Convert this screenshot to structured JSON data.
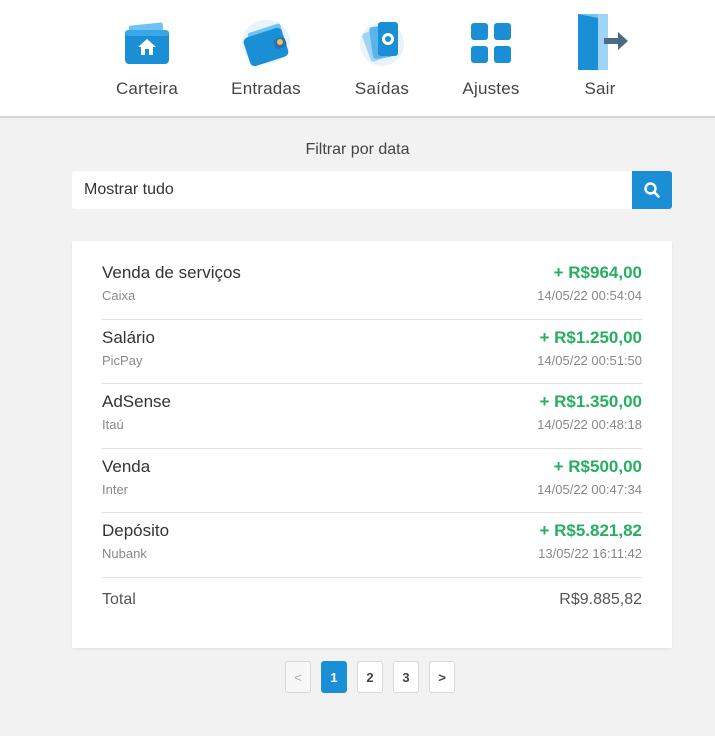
{
  "nav": {
    "items": [
      {
        "label": "Carteira",
        "icon": "wallet-home-icon"
      },
      {
        "label": "Entradas",
        "icon": "wallet-in-icon"
      },
      {
        "label": "Saídas",
        "icon": "money-out-icon"
      },
      {
        "label": "Ajustes",
        "icon": "grid-settings-icon"
      },
      {
        "label": "Sair",
        "icon": "exit-door-icon"
      }
    ]
  },
  "filter": {
    "title": "Filtrar por data",
    "placeholder": "Mostrar tudo",
    "value": ""
  },
  "transactions": [
    {
      "name": "Venda de serviços",
      "account": "Caixa",
      "amount": "+ R$964,00",
      "date": "14/05/22 00:54:04"
    },
    {
      "name": "Salário",
      "account": "PicPay",
      "amount": "+ R$1.250,00",
      "date": "14/05/22 00:51:50"
    },
    {
      "name": "AdSense",
      "account": "Itaú",
      "amount": "+ R$1.350,00",
      "date": "14/05/22 00:48:18"
    },
    {
      "name": "Venda",
      "account": "Inter",
      "amount": "+ R$500,00",
      "date": "14/05/22 00:47:34"
    },
    {
      "name": "Depósito",
      "account": "Nubank",
      "amount": "+ R$5.821,82",
      "date": "13/05/22 16:11:42"
    }
  ],
  "total": {
    "label": "Total",
    "value": "R$9.885,82"
  },
  "pagination": {
    "prev": "<",
    "pages": [
      "1",
      "2",
      "3"
    ],
    "next": ">",
    "current": "1"
  },
  "colors": {
    "accent": "#1a8fd6",
    "positive": "#27ae60"
  }
}
